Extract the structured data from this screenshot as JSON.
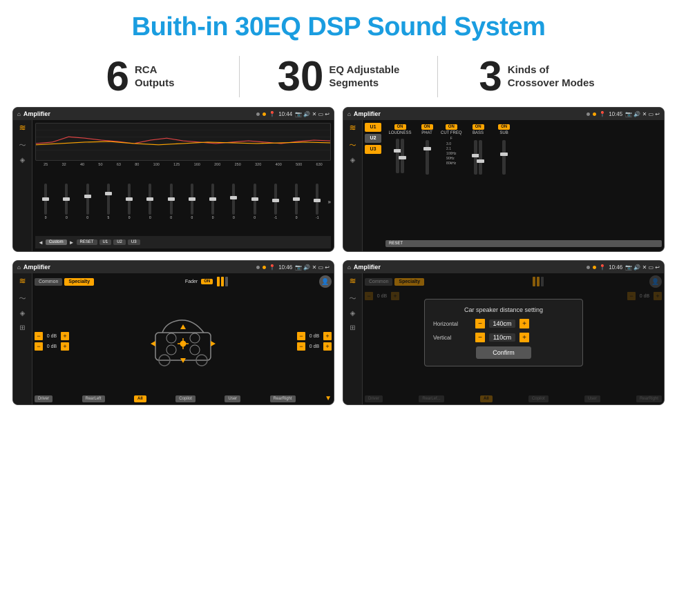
{
  "title": "Buith-in 30EQ DSP Sound System",
  "stats": [
    {
      "number": "6",
      "label": "RCA\nOutputs"
    },
    {
      "number": "30",
      "label": "EQ Adjustable\nSegments"
    },
    {
      "number": "3",
      "label": "Kinds of\nCrossover Modes"
    }
  ],
  "screen_tl": {
    "status": {
      "time": "10:44",
      "title": "Amplifier"
    },
    "freq_labels": [
      "25",
      "32",
      "40",
      "50",
      "63",
      "80",
      "100",
      "125",
      "160",
      "200",
      "250",
      "320",
      "400",
      "500",
      "630"
    ],
    "slider_vals": [
      "0",
      "0",
      "0",
      "5",
      "0",
      "0",
      "0",
      "0",
      "0",
      "0",
      "0",
      "-1",
      "0",
      "-1"
    ],
    "buttons": [
      "Custom",
      "RESET",
      "U1",
      "U2",
      "U3"
    ]
  },
  "screen_tr": {
    "status": {
      "time": "10:45",
      "title": "Amplifier"
    },
    "presets": [
      "U1",
      "U2",
      "U3"
    ],
    "controls": [
      "LOUDNESS",
      "PHAT",
      "CUT FREQ",
      "BASS",
      "SUB"
    ],
    "on_labels": [
      "ON",
      "ON",
      "ON",
      "ON",
      "ON"
    ],
    "reset_label": "RESET"
  },
  "screen_bl": {
    "status": {
      "time": "10:46",
      "title": "Amplifier"
    },
    "tabs": [
      "Common",
      "Specialty"
    ],
    "fader_label": "Fader",
    "fader_on": "ON",
    "db_values": [
      "0 dB",
      "0 dB",
      "0 dB",
      "0 dB"
    ],
    "buttons": [
      "Driver",
      "RearLeft",
      "All",
      "Copilot",
      "User",
      "RearRight"
    ]
  },
  "screen_br": {
    "status": {
      "time": "10:46",
      "title": "Amplifier"
    },
    "tabs": [
      "Common",
      "Specialty"
    ],
    "dialog": {
      "title": "Car speaker distance setting",
      "horizontal_label": "Horizontal",
      "horizontal_value": "140cm",
      "vertical_label": "Vertical",
      "vertical_value": "110cm",
      "confirm_label": "Confirm"
    },
    "db_values": [
      "0 dB",
      "0 dB"
    ],
    "buttons": [
      "Driver",
      "RearLef...",
      "All",
      "Copilot",
      "User",
      "RearRight"
    ]
  },
  "icons": {
    "home": "⌂",
    "play": "▶",
    "pause": "⏸",
    "location": "📍",
    "camera": "📷",
    "speaker": "🔊",
    "wifi": "✕",
    "window": "▭",
    "back": "↩",
    "eq_icon": "≋",
    "wave_icon": "〜",
    "speaker_icon": "◈",
    "fader_icon": "⊞"
  }
}
